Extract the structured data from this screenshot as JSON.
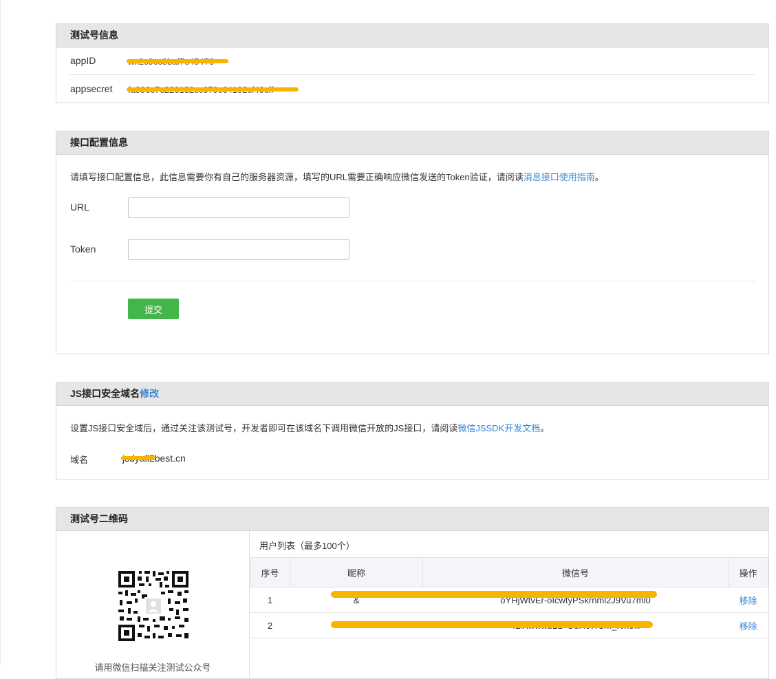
{
  "test_info": {
    "header": "测试号信息",
    "appid_label": "appID",
    "appid_value": "wx2c9cc8baf7c45476",
    "appsecret_label": "appsecret",
    "appsecret_value": "fa896c7c226132cc679c64102cf49cff"
  },
  "api_config": {
    "header": "接口配置信息",
    "desc_text": "请填写接口配置信息，此信息需要你有自己的服务器资源，填写的URL需要正确响应微信发送的Token验证，请阅读",
    "desc_link": "消息接口使用指南",
    "desc_end": "。",
    "url_label": "URL",
    "url_value": "",
    "token_label": "Token",
    "token_value": "",
    "submit_label": "提交"
  },
  "js_domain": {
    "header": "JS接口安全域名",
    "edit_link": "修改",
    "desc_text": "设置JS接口安全域后，通过关注该测试号，开发者即可在该域名下调用微信开放的JS接口，请阅读",
    "desc_link": "微信JSSDK开发文档",
    "desc_end": "。",
    "domain_label": "域名",
    "domain_value": "jsdyall2best.cn"
  },
  "qrcode": {
    "header": "测试号二维码",
    "caption": "请用微信扫描关注测试公众号",
    "user_list_title": "用户列表（最多100个）",
    "columns": [
      "序号",
      "昵称",
      "微信号",
      "操作"
    ],
    "rows": [
      {
        "index": "1",
        "nickname": "&",
        "wechat_id": "oYHjWtvEr-oIcwtyPSkrnml2J9Vu7ml0",
        "action": "移除"
      },
      {
        "index": "2",
        "nickname": "",
        "wechat_id": "41iKwwwb2D-O8H07ICM_rvn5w",
        "action": "移除"
      }
    ]
  },
  "colors": {
    "header_bg": "#e6e6e6",
    "link": "#3a87d0",
    "submit_green": "#44b549",
    "redaction": "#f7b500"
  }
}
